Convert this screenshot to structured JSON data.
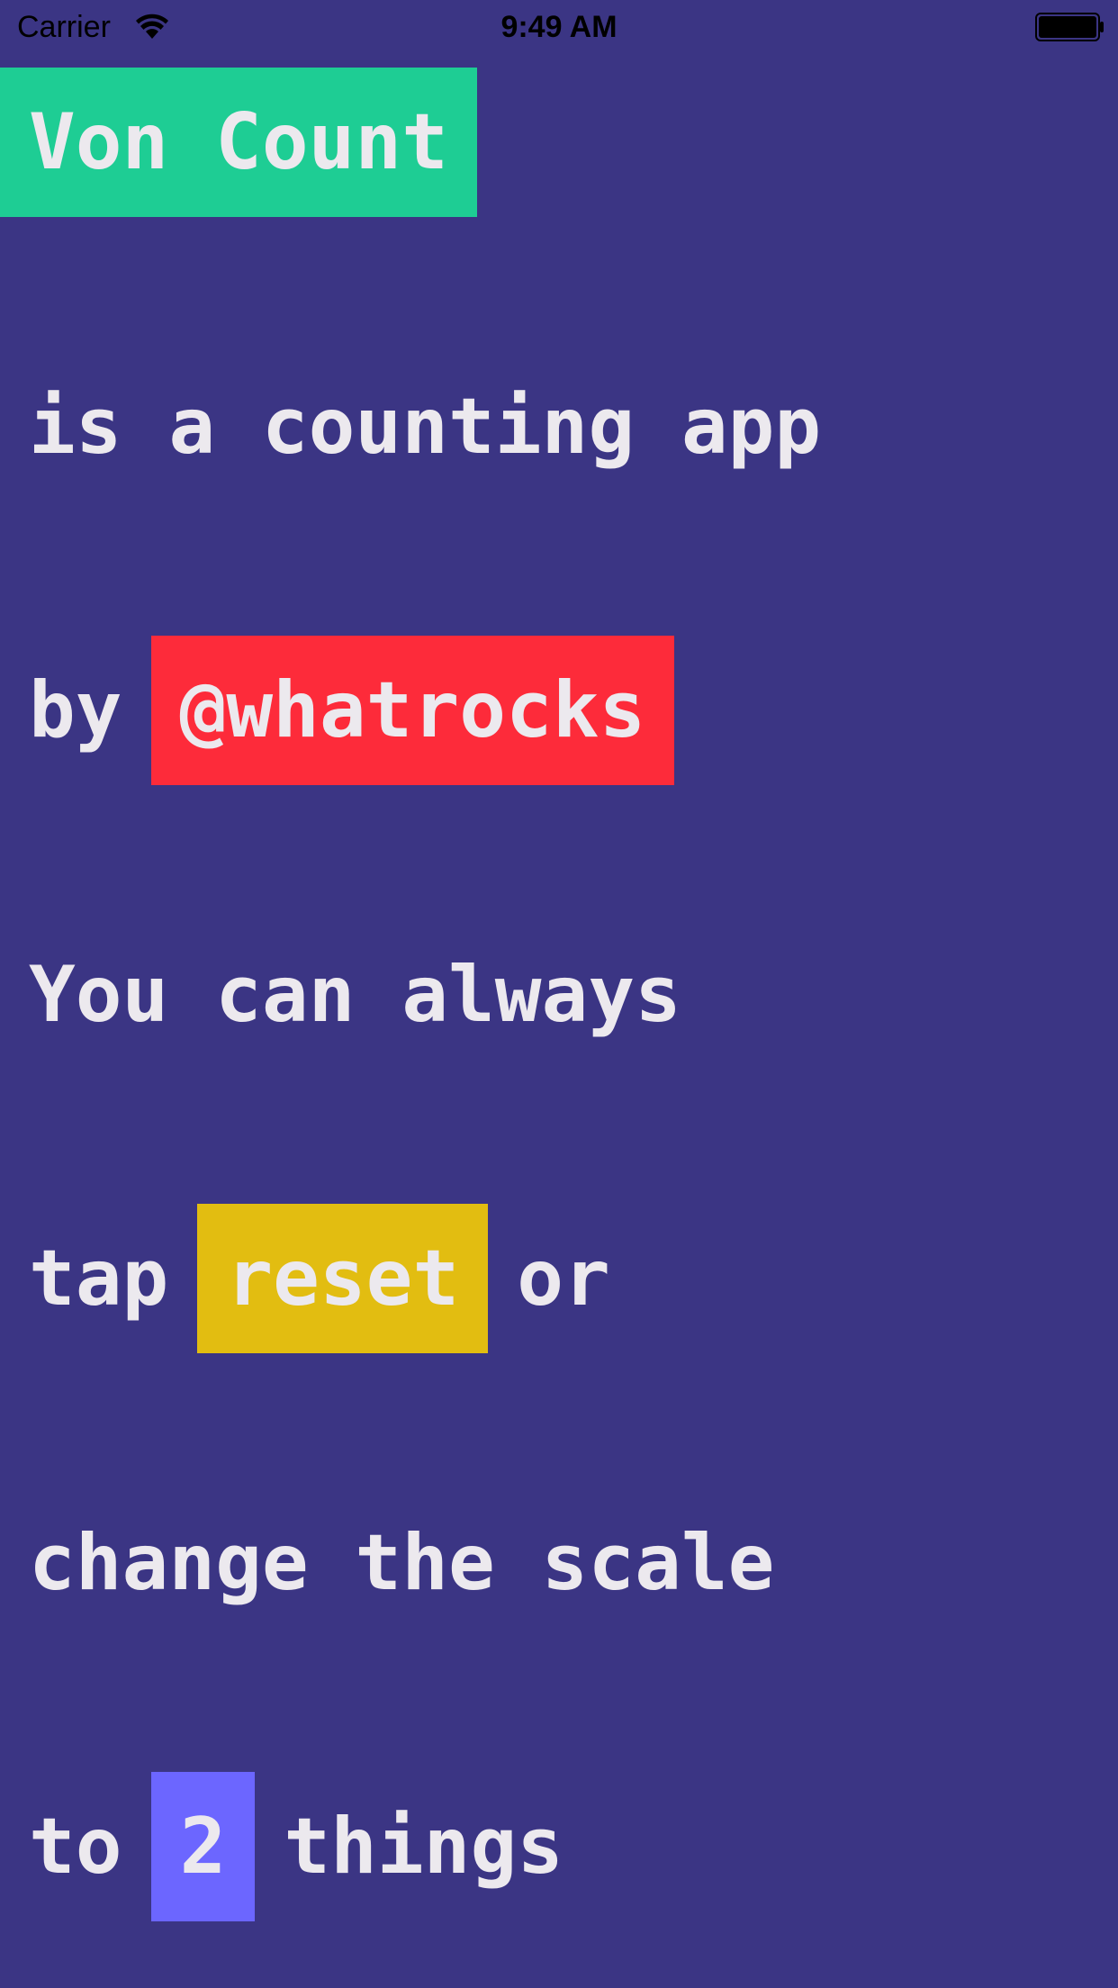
{
  "status_bar": {
    "carrier": "Carrier",
    "time": "9:49 AM",
    "icons": [
      "wifi-icon",
      "battery-icon"
    ]
  },
  "colors": {
    "background": "#3b3584",
    "text": "#ece9ee",
    "title_chip": "#1ecd94",
    "handle_chip": "#fd2b3a",
    "reset_chip": "#e2bd11",
    "scale_chip": "#6c66ff"
  },
  "content": {
    "title": "Von Count",
    "line1": "is a counting app",
    "line2_prefix": "by",
    "handle": "@whatrocks",
    "line3": "You can always",
    "line4_prefix": "tap",
    "reset_label": "reset",
    "line4_suffix": "or",
    "line5": "change the scale",
    "line6_prefix": "to",
    "scale_value": "2",
    "line6_suffix": "things"
  }
}
